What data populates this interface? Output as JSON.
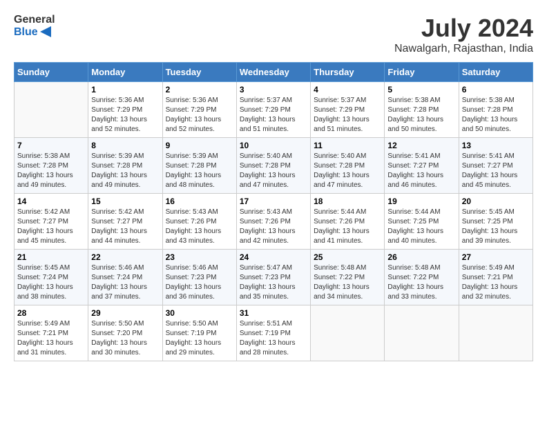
{
  "header": {
    "logo_line1": "General",
    "logo_line2": "Blue",
    "month_year": "July 2024",
    "location": "Nawalgarh, Rajasthan, India"
  },
  "days_of_week": [
    "Sunday",
    "Monday",
    "Tuesday",
    "Wednesday",
    "Thursday",
    "Friday",
    "Saturday"
  ],
  "weeks": [
    [
      {
        "day": "",
        "content": ""
      },
      {
        "day": "1",
        "content": "Sunrise: 5:36 AM\nSunset: 7:29 PM\nDaylight: 13 hours\nand 52 minutes."
      },
      {
        "day": "2",
        "content": "Sunrise: 5:36 AM\nSunset: 7:29 PM\nDaylight: 13 hours\nand 52 minutes."
      },
      {
        "day": "3",
        "content": "Sunrise: 5:37 AM\nSunset: 7:29 PM\nDaylight: 13 hours\nand 51 minutes."
      },
      {
        "day": "4",
        "content": "Sunrise: 5:37 AM\nSunset: 7:29 PM\nDaylight: 13 hours\nand 51 minutes."
      },
      {
        "day": "5",
        "content": "Sunrise: 5:38 AM\nSunset: 7:28 PM\nDaylight: 13 hours\nand 50 minutes."
      },
      {
        "day": "6",
        "content": "Sunrise: 5:38 AM\nSunset: 7:28 PM\nDaylight: 13 hours\nand 50 minutes."
      }
    ],
    [
      {
        "day": "7",
        "content": "Sunrise: 5:38 AM\nSunset: 7:28 PM\nDaylight: 13 hours\nand 49 minutes."
      },
      {
        "day": "8",
        "content": "Sunrise: 5:39 AM\nSunset: 7:28 PM\nDaylight: 13 hours\nand 49 minutes."
      },
      {
        "day": "9",
        "content": "Sunrise: 5:39 AM\nSunset: 7:28 PM\nDaylight: 13 hours\nand 48 minutes."
      },
      {
        "day": "10",
        "content": "Sunrise: 5:40 AM\nSunset: 7:28 PM\nDaylight: 13 hours\nand 47 minutes."
      },
      {
        "day": "11",
        "content": "Sunrise: 5:40 AM\nSunset: 7:28 PM\nDaylight: 13 hours\nand 47 minutes."
      },
      {
        "day": "12",
        "content": "Sunrise: 5:41 AM\nSunset: 7:27 PM\nDaylight: 13 hours\nand 46 minutes."
      },
      {
        "day": "13",
        "content": "Sunrise: 5:41 AM\nSunset: 7:27 PM\nDaylight: 13 hours\nand 45 minutes."
      }
    ],
    [
      {
        "day": "14",
        "content": "Sunrise: 5:42 AM\nSunset: 7:27 PM\nDaylight: 13 hours\nand 45 minutes."
      },
      {
        "day": "15",
        "content": "Sunrise: 5:42 AM\nSunset: 7:27 PM\nDaylight: 13 hours\nand 44 minutes."
      },
      {
        "day": "16",
        "content": "Sunrise: 5:43 AM\nSunset: 7:26 PM\nDaylight: 13 hours\nand 43 minutes."
      },
      {
        "day": "17",
        "content": "Sunrise: 5:43 AM\nSunset: 7:26 PM\nDaylight: 13 hours\nand 42 minutes."
      },
      {
        "day": "18",
        "content": "Sunrise: 5:44 AM\nSunset: 7:26 PM\nDaylight: 13 hours\nand 41 minutes."
      },
      {
        "day": "19",
        "content": "Sunrise: 5:44 AM\nSunset: 7:25 PM\nDaylight: 13 hours\nand 40 minutes."
      },
      {
        "day": "20",
        "content": "Sunrise: 5:45 AM\nSunset: 7:25 PM\nDaylight: 13 hours\nand 39 minutes."
      }
    ],
    [
      {
        "day": "21",
        "content": "Sunrise: 5:45 AM\nSunset: 7:24 PM\nDaylight: 13 hours\nand 38 minutes."
      },
      {
        "day": "22",
        "content": "Sunrise: 5:46 AM\nSunset: 7:24 PM\nDaylight: 13 hours\nand 37 minutes."
      },
      {
        "day": "23",
        "content": "Sunrise: 5:46 AM\nSunset: 7:23 PM\nDaylight: 13 hours\nand 36 minutes."
      },
      {
        "day": "24",
        "content": "Sunrise: 5:47 AM\nSunset: 7:23 PM\nDaylight: 13 hours\nand 35 minutes."
      },
      {
        "day": "25",
        "content": "Sunrise: 5:48 AM\nSunset: 7:22 PM\nDaylight: 13 hours\nand 34 minutes."
      },
      {
        "day": "26",
        "content": "Sunrise: 5:48 AM\nSunset: 7:22 PM\nDaylight: 13 hours\nand 33 minutes."
      },
      {
        "day": "27",
        "content": "Sunrise: 5:49 AM\nSunset: 7:21 PM\nDaylight: 13 hours\nand 32 minutes."
      }
    ],
    [
      {
        "day": "28",
        "content": "Sunrise: 5:49 AM\nSunset: 7:21 PM\nDaylight: 13 hours\nand 31 minutes."
      },
      {
        "day": "29",
        "content": "Sunrise: 5:50 AM\nSunset: 7:20 PM\nDaylight: 13 hours\nand 30 minutes."
      },
      {
        "day": "30",
        "content": "Sunrise: 5:50 AM\nSunset: 7:19 PM\nDaylight: 13 hours\nand 29 minutes."
      },
      {
        "day": "31",
        "content": "Sunrise: 5:51 AM\nSunset: 7:19 PM\nDaylight: 13 hours\nand 28 minutes."
      },
      {
        "day": "",
        "content": ""
      },
      {
        "day": "",
        "content": ""
      },
      {
        "day": "",
        "content": ""
      }
    ]
  ]
}
